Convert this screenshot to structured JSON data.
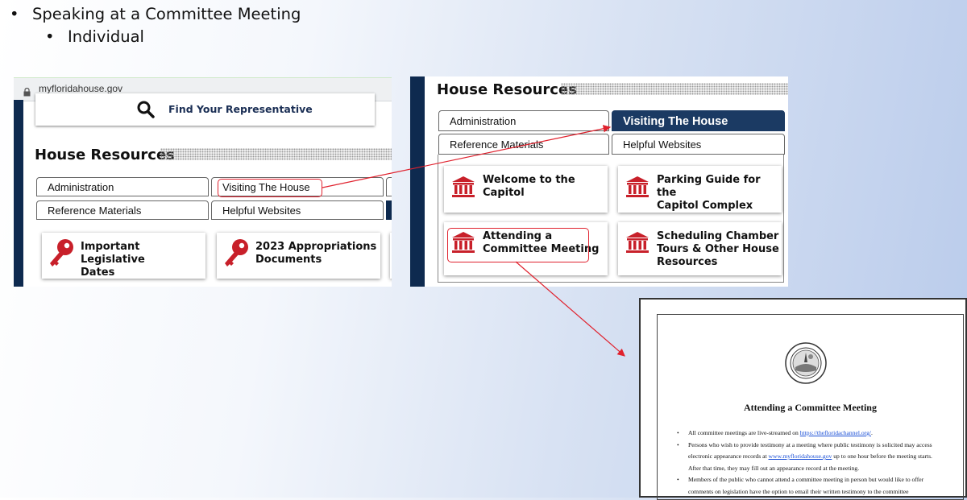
{
  "slide": {
    "bullet1": "Speaking at a Committee Meeting",
    "bullet2": "Individual",
    "bullet_glyph": "•"
  },
  "left_screenshot": {
    "url": "myfloridahouse.gov",
    "find_rep": "Find Your Representative",
    "heading": "House Resources",
    "tabs": [
      "Administration",
      "Visiting The House",
      "Reference Materials",
      "Helpful Websites"
    ],
    "cards": [
      "Important Legislative\nDates",
      "2023 Appropriations\nDocuments"
    ],
    "icons": {
      "search": "search-icon",
      "lock": "lock-icon",
      "key": "key-icon"
    }
  },
  "right_screenshot": {
    "heading": "House Resources",
    "tabs": [
      "Administration",
      "Visiting The House",
      "Reference Materials",
      "Helpful Websites"
    ],
    "cards": [
      "Welcome to the\nCapitol",
      "Parking Guide for the\nCapitol Complex",
      "Attending a\nCommittee Meeting",
      "Scheduling Chamber\nTours & Other House\nResources"
    ],
    "icons": {
      "building": "capitol-building-icon"
    }
  },
  "document": {
    "title": "Attending a Committee Meeting",
    "items": [
      {
        "pre": "All committee meetings are live-streamed on ",
        "link": "https://thefloridachannel.org/",
        "post": "."
      },
      {
        "pre": "Persons who wish to provide testimony at a meeting where public testimony is solicited may access electronic appearance records at ",
        "link": "www.myfloridahouse.gov",
        "post": " up to one hour before the meeting starts.  After that time, they may fill out an appearance record at the meeting."
      },
      {
        "pre": "Members of the public who cannot attend a committee meeting in person but would like to offer comments on legislation have the option to email their written testimony to the committee",
        "link": "",
        "post": ""
      }
    ],
    "seal": "florida-house-seal"
  },
  "colors": {
    "navy": "#0e2a4f",
    "active_tab": "#1b3a63",
    "highlight": "#e0222e",
    "icon_red": "#c8202a"
  }
}
